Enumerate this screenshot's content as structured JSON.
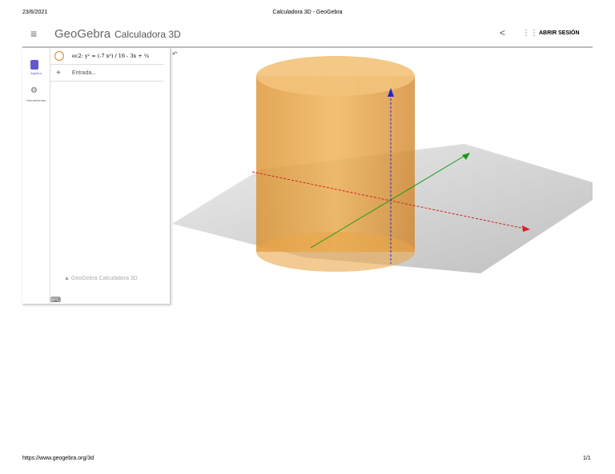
{
  "print_header": {
    "date": "23/6/2021",
    "title": "Calculadora 3D - GeoGebra"
  },
  "print_footer": {
    "url": "https://www.geogebra.org/3d",
    "page": "1/1"
  },
  "app": {
    "logo": "GeoGebra",
    "name": "Calculadora 3D",
    "signin": "ABRIR SESIÓN"
  },
  "sidebar": {
    "items": [
      {
        "label": "Álgebra",
        "icon": "calculator-icon"
      },
      {
        "label": "Herramientas",
        "icon": "tools-icon"
      }
    ]
  },
  "algebra": {
    "rows": [
      {
        "text": "ec2: y² = (-7 x²) / 16 - 3x + ¼"
      }
    ],
    "input_placeholder": "Entrada...",
    "watermark": "GeoGebra Calculadora 3D"
  },
  "colors": {
    "cylinder": "#e8a030",
    "x_axis": "#d42020",
    "y_axis": "#1a9a1a",
    "z_axis": "#1a2ad4"
  }
}
